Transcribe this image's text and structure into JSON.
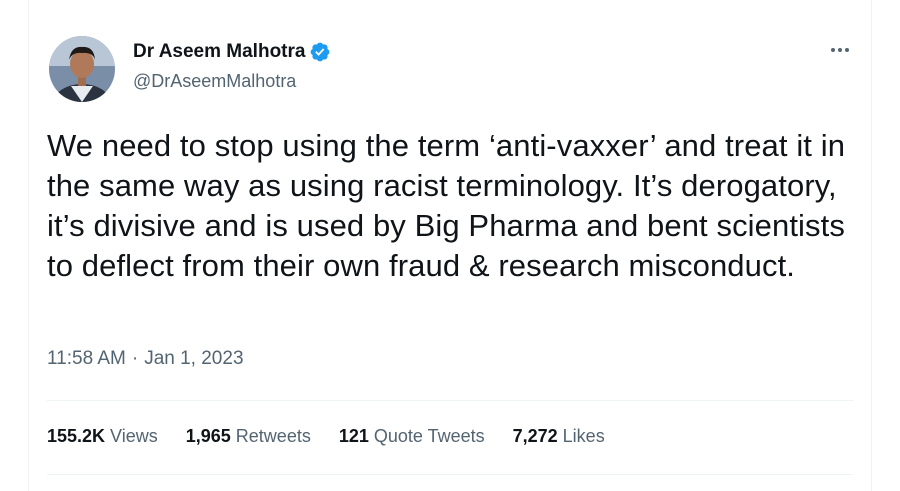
{
  "author": {
    "name": "Dr Aseem Malhotra",
    "handle": "@DrAseemMalhotra",
    "verified_color": "#1d9bf0"
  },
  "tweet": {
    "text": "We need to stop using the term ‘anti-vaxxer’ and treat it in the same way as using racist terminology. It’s derogatory, it’s divisive and is used by Big Pharma and bent scientists to deflect from their own fraud & research misconduct.",
    "time": "11:58 AM",
    "separator": "·",
    "date": "Jan 1, 2023"
  },
  "stats": {
    "views_count": "155.2K",
    "views_label": "Views",
    "retweets_count": "1,965",
    "retweets_label": "Retweets",
    "quotes_count": "121",
    "quotes_label": "Quote Tweets",
    "likes_count": "7,272",
    "likes_label": "Likes"
  },
  "icons": {
    "verified": "verified-badge-icon",
    "more": "more-options-icon"
  }
}
